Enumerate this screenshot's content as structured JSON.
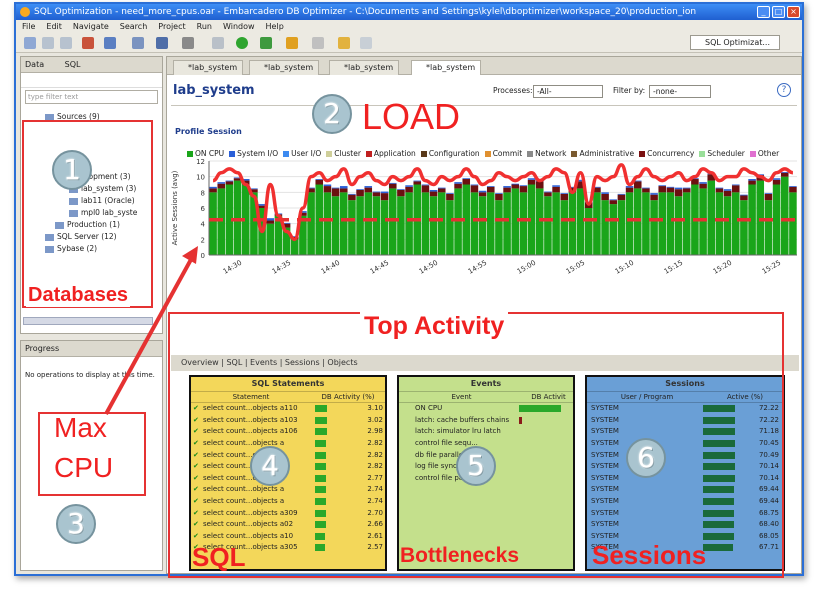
{
  "window": {
    "title": "SQL Optimization - need_more_cpus.oar - Embarcadero DB Optimizer - C:\\Documents and Settings\\kylel\\dboptimizer\\workspace_20\\production_ion"
  },
  "menu": [
    "File",
    "Edit",
    "Navigate",
    "Search",
    "Project",
    "Run",
    "Window",
    "Help"
  ],
  "perspective": {
    "label": "SQL Optimizat..."
  },
  "data_view": {
    "tabs": [
      "Data",
      "SQL"
    ],
    "filter_placeholder": "type filter text",
    "tree": [
      {
        "label": "Sources (9)"
      },
      {
        "label": "Development (3)"
      },
      {
        "label": "lab_system (3)"
      },
      {
        "label": "lab11 (Oracle)"
      },
      {
        "label": "mpl0 lab_syste"
      },
      {
        "label": "Production (1)"
      },
      {
        "label": "SQL Server (12)"
      },
      {
        "label": "Sybase (2)"
      }
    ]
  },
  "progress_view": {
    "tab": "Progress",
    "message": "No operations to display at this time."
  },
  "editor": {
    "tabs": [
      "*lab_system",
      "*lab_system",
      "*lab_system",
      "*lab_system"
    ],
    "title": "lab_system",
    "processes_label": "Processes:",
    "processes_value": "-All-",
    "filter_label": "Filter by:",
    "filter_value": "-none-",
    "section": "Profile Session",
    "bottom_tabs": "Overview | SQL | Events | Sessions | Objects"
  },
  "legend": [
    {
      "name": "ON CPU",
      "color": "#1aa51a"
    },
    {
      "name": "System I/O",
      "color": "#2a5fd8"
    },
    {
      "name": "User I/O",
      "color": "#3c8af0"
    },
    {
      "name": "Cluster",
      "color": "#cfcf9a"
    },
    {
      "name": "Application",
      "color": "#c02020"
    },
    {
      "name": "Configuration",
      "color": "#5a3a1a"
    },
    {
      "name": "Commit",
      "color": "#e09030"
    },
    {
      "name": "Network",
      "color": "#8a8a8a"
    },
    {
      "name": "Administrative",
      "color": "#7a5a30"
    },
    {
      "name": "Concurrency",
      "color": "#7a1010"
    },
    {
      "name": "Scheduler",
      "color": "#9adf9a"
    },
    {
      "name": "Other",
      "color": "#e070d0"
    }
  ],
  "chart_data": {
    "type": "bar",
    "ylabel": "Active Sessions (avg)",
    "ylim": [
      0,
      12
    ],
    "xticks": [
      "14:30",
      "14:35",
      "14:40",
      "14:45",
      "14:50",
      "14:55",
      "15:00",
      "15:05",
      "15:10",
      "15:15",
      "15:20",
      "15:25"
    ],
    "max_cpu_line": 4.5,
    "series": [
      {
        "name": "ON CPU",
        "values": [
          8,
          8.5,
          9,
          9.5,
          9,
          8,
          6,
          4,
          5,
          3.5,
          2,
          5,
          8,
          9,
          8,
          7.5,
          8,
          7,
          7.5,
          8,
          7.5,
          7,
          8.5,
          7.5,
          8,
          9,
          8,
          7.5,
          8,
          7,
          8.5,
          9,
          8,
          7.5,
          8,
          7,
          8,
          8.5,
          8,
          9,
          8.5,
          7.5,
          8,
          7,
          8,
          8.5,
          6,
          8,
          7,
          6.5,
          7,
          8,
          8.5,
          8,
          7,
          8,
          8,
          7.5,
          8,
          9,
          8.5,
          9.5,
          8,
          7.5,
          8,
          7,
          9,
          9.5,
          7,
          9,
          10,
          8
        ]
      },
      {
        "name": "Concurrency",
        "values": [
          0.5,
          0.6,
          0.4,
          0.3,
          0.5,
          0.4,
          0.3,
          0.4,
          0.2,
          0.5,
          0.3,
          0.4,
          0.5,
          0.6,
          0.8,
          1,
          0.5,
          0.7,
          0.8,
          0.6,
          0.5,
          0.9,
          0.6,
          0.8,
          0.7,
          0.4,
          0.9,
          0.6,
          0.5,
          0.8,
          0.6,
          0.7,
          0.9,
          0.5,
          0.7,
          0.8,
          0.6,
          0.5,
          0.8,
          0.6,
          0.9,
          0.5,
          0.7,
          0.8,
          0.6,
          0.9,
          0.7,
          0.6,
          0.8,
          0.5,
          0.7,
          0.6,
          0.9,
          0.5,
          0.7,
          0.8,
          0.6,
          0.9,
          0.5,
          0.7,
          0.6,
          0.8,
          0.5,
          0.7,
          0.9,
          0.6,
          0.5,
          0.7,
          0.8,
          0.6,
          0.5,
          0.7
        ]
      },
      {
        "name": "User I/O",
        "values": [
          0.2,
          0.2,
          0.1,
          0.1,
          0.2,
          0.1,
          0.2,
          0.3,
          0.1,
          0.1,
          0.1,
          0.2,
          0.1,
          0.1,
          0.2,
          0.1,
          0.3,
          0.1,
          0.1,
          0.2,
          0.1,
          0.2,
          0.1,
          0.1,
          0.2,
          0.1,
          0.1,
          0.2,
          0.1,
          0.1,
          0.2,
          0.1,
          0.1,
          0.2,
          0.1,
          0.1,
          0.2,
          0.1,
          0.1,
          0.2,
          0.1,
          0.1,
          0.2,
          0.1,
          0.1,
          0.2,
          0.1,
          0.1,
          0.2,
          0.1,
          0.1,
          0.2,
          0.1,
          0.1,
          0.2,
          0.1,
          0.1,
          0.2,
          0.1,
          0.1,
          0.2,
          0.1,
          0.1,
          0.2,
          0.1,
          0.1,
          0.2,
          0.1,
          0.1,
          0.2,
          0.1,
          0.1
        ]
      }
    ],
    "load_line": [
      9.5,
      10.5,
      11,
      10.5,
      9,
      7.5,
      3,
      9,
      5,
      3,
      2,
      6,
      10,
      10.5,
      9.5,
      10,
      11,
      9,
      10,
      10.5,
      9.5,
      9,
      10,
      9.5,
      10,
      11,
      9.5,
      9,
      10,
      9.5,
      10,
      11,
      10,
      9,
      9.5,
      10.5,
      10,
      9.5,
      10,
      10.5,
      9.5,
      10,
      11,
      10.5,
      8,
      10.5,
      6.5,
      10,
      9.5,
      10,
      11.5,
      9,
      10,
      11,
      10,
      9.5,
      10,
      10.5,
      9.5,
      10,
      11,
      10.5,
      9.5,
      10,
      10,
      11,
      10.5,
      10,
      9.5,
      10.5,
      11,
      10.5
    ]
  },
  "sql_panel": {
    "title": "SQL Statements",
    "cols": [
      "Statement",
      "DB Activity (%)"
    ],
    "rows": [
      {
        "stmt": "select count...objects a110",
        "pct": "3.10"
      },
      {
        "stmt": "select count...objects a103",
        "pct": "3.02"
      },
      {
        "stmt": "select count...objects a106",
        "pct": "2.98"
      },
      {
        "stmt": "select count...objects a",
        "pct": "2.82"
      },
      {
        "stmt": "select count...objects a",
        "pct": "2.82"
      },
      {
        "stmt": "select count...objects a",
        "pct": "2.82"
      },
      {
        "stmt": "select count...objects a",
        "pct": "2.77"
      },
      {
        "stmt": "select count...objects a",
        "pct": "2.74"
      },
      {
        "stmt": "select count...objects a",
        "pct": "2.74"
      },
      {
        "stmt": "select count...objects a309",
        "pct": "2.70"
      },
      {
        "stmt": "select count...objects a02",
        "pct": "2.66"
      },
      {
        "stmt": "select count...objects a10",
        "pct": "2.61"
      },
      {
        "stmt": "select count...objects a305",
        "pct": "2.57"
      }
    ]
  },
  "events_panel": {
    "title": "Events",
    "cols": [
      "Event",
      "DB Activit"
    ],
    "rows": [
      {
        "event": "ON CPU"
      },
      {
        "event": "latch: cache buffers chains"
      },
      {
        "event": "latch: simulator lru latch"
      },
      {
        "event": "control file sequ..."
      },
      {
        "event": "db file parallel..."
      },
      {
        "event": "log file sync"
      },
      {
        "event": "control file pa..."
      }
    ]
  },
  "sessions_panel": {
    "title": "Sessions",
    "cols": [
      "User / Program",
      "Active (%)"
    ],
    "rows": [
      {
        "user": "SYSTEM",
        "pct": "72.22"
      },
      {
        "user": "SYSTEM",
        "pct": "72.22"
      },
      {
        "user": "SYSTEM",
        "pct": "71.18"
      },
      {
        "user": "SYSTEM",
        "pct": "70.45"
      },
      {
        "user": "SYSTEM",
        "pct": "70.49"
      },
      {
        "user": "SYSTEM",
        "pct": "70.14"
      },
      {
        "user": "SYSTEM",
        "pct": "70.14"
      },
      {
        "user": "SYSTEM",
        "pct": "69.44"
      },
      {
        "user": "SYSTEM",
        "pct": "69.44"
      },
      {
        "user": "SYSTEM",
        "pct": "68.75"
      },
      {
        "user": "SYSTEM",
        "pct": "68.40"
      },
      {
        "user": "SYSTEM",
        "pct": "68.05"
      },
      {
        "user": "SYSTEM",
        "pct": "67.71"
      }
    ]
  },
  "annotations": {
    "n1": "1",
    "n2": "2",
    "n3": "3",
    "n4": "4",
    "n5": "5",
    "n6": "6",
    "load": "LOAD",
    "databases": "Databases",
    "top_activity": "Top Activity",
    "max_cpu_1": "Max",
    "max_cpu_2": "CPU",
    "sql": "SQL",
    "bottlenecks": "Bottlenecks",
    "sessions": "Sessions"
  }
}
